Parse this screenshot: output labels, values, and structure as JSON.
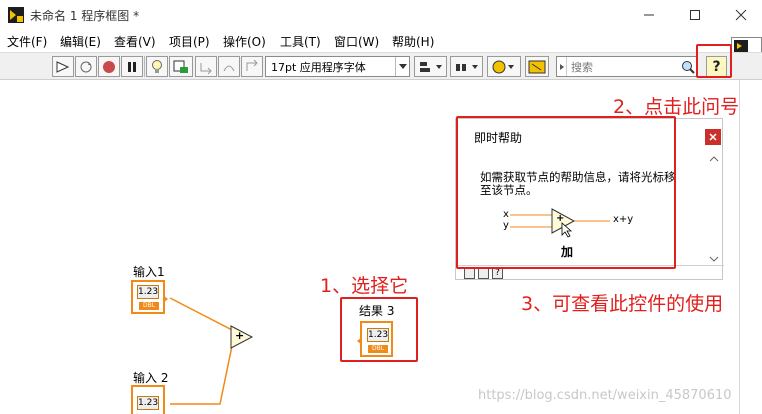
{
  "window": {
    "title": "未命名 1 程序框图 *"
  },
  "menu": [
    "文件(F)",
    "编辑(E)",
    "查看(V)",
    "项目(P)",
    "操作(O)",
    "工具(T)",
    "窗口(W)",
    "帮助(H)"
  ],
  "toolbar": {
    "font_selector": "17pt 应用程序字体",
    "search_placeholder": "搜索",
    "help_button_label": "?"
  },
  "help_window": {
    "title": "即时帮助",
    "description": "如需获取节点的帮助信息，请将光标移至该节点。",
    "input_x": "x",
    "input_y": "y",
    "output": "x+y",
    "function_name": "加"
  },
  "nodes": {
    "input1": {
      "label": "输入1",
      "value": "1.23",
      "type": "DBL"
    },
    "input2": {
      "label": "输入 2",
      "value": "1.23",
      "type": "DBL"
    },
    "result": {
      "label": "结果 3",
      "value": "1.23",
      "type": "DBL"
    },
    "add_symbol": "+"
  },
  "annotations": {
    "step1": "1、选择它",
    "step2": "2、点击此问号",
    "step3": "3、可查看此控件的使用"
  },
  "watermark": "https://blog.csdn.net/weixin_45870610",
  "colors": {
    "annotation": "#e0201e",
    "terminal_border": "#f08a18",
    "wire": "#f08a18"
  }
}
